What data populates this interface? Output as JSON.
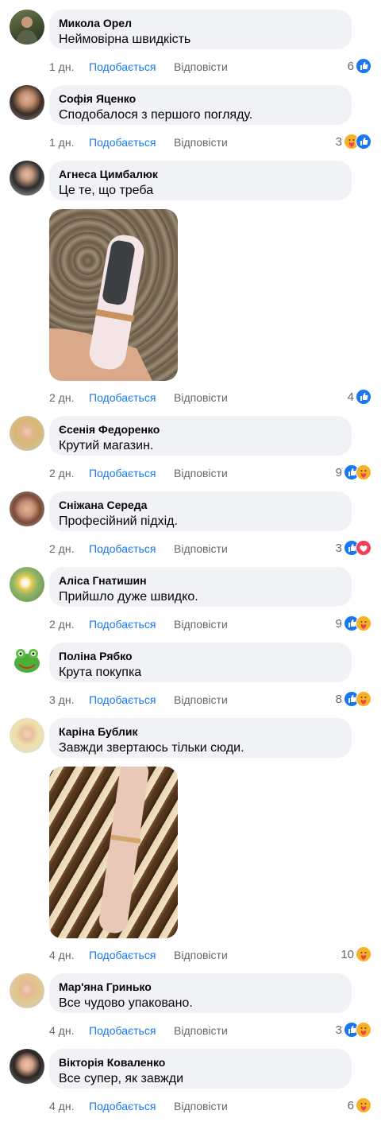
{
  "actions": {
    "like": "Подобається",
    "reply": "Відповісти"
  },
  "colors": {
    "bubble": "#f0f2f5",
    "link": "#1877f2",
    "meta": "#65676b",
    "like_reaction": "#1877f2",
    "care_reaction": "#f7b125",
    "love_reaction": "#f33e58"
  },
  "comments": [
    {
      "author": "Микола Орел",
      "text": "Неймовірна швидкість",
      "time": "1 дн.",
      "count": "6",
      "reactions": [
        "like"
      ]
    },
    {
      "author": "Софія Яценко",
      "text": "Сподобалося з першого погляду.",
      "time": "1 дн.",
      "count": "3",
      "reactions": [
        "care",
        "like"
      ]
    },
    {
      "author": "Агнеса Цимбалюк",
      "text": "Це те, що треба",
      "time": "2 дн.",
      "count": "4",
      "reactions": [
        "like"
      ],
      "attachment": "photo-device-in-hand"
    },
    {
      "author": "Єсенія Федоренко",
      "text": "Крутий магазин.",
      "time": "2 дн.",
      "count": "9",
      "reactions": [
        "like",
        "care"
      ]
    },
    {
      "author": "Сніжана Середа",
      "text": "Професійний підхід.",
      "time": "2 дн.",
      "count": "3",
      "reactions": [
        "like",
        "love"
      ]
    },
    {
      "author": "Аліса Гнатишин",
      "text": "Прийшло дуже швидко.",
      "time": "2 дн.",
      "count": "9",
      "reactions": [
        "like",
        "care"
      ]
    },
    {
      "author": "Поліна Рябко",
      "text": "Крута покупка",
      "time": "3 дн.",
      "count": "8",
      "reactions": [
        "like",
        "care"
      ]
    },
    {
      "author": "Каріна Бублик",
      "text": "Завжди звертаюсь тільки сюди.",
      "time": "4 дн.",
      "count": "10",
      "reactions": [
        "care"
      ],
      "attachment": "photo-device-on-carpet"
    },
    {
      "author": "Мар'яна Гринько",
      "text": "Все чудово упаковано.",
      "time": "4 дн.",
      "count": "3",
      "reactions": [
        "like",
        "care"
      ]
    },
    {
      "author": "Вікторія Коваленко",
      "text": "Все супер, як завжди",
      "time": "4 дн.",
      "count": "6",
      "reactions": [
        "care"
      ]
    }
  ]
}
